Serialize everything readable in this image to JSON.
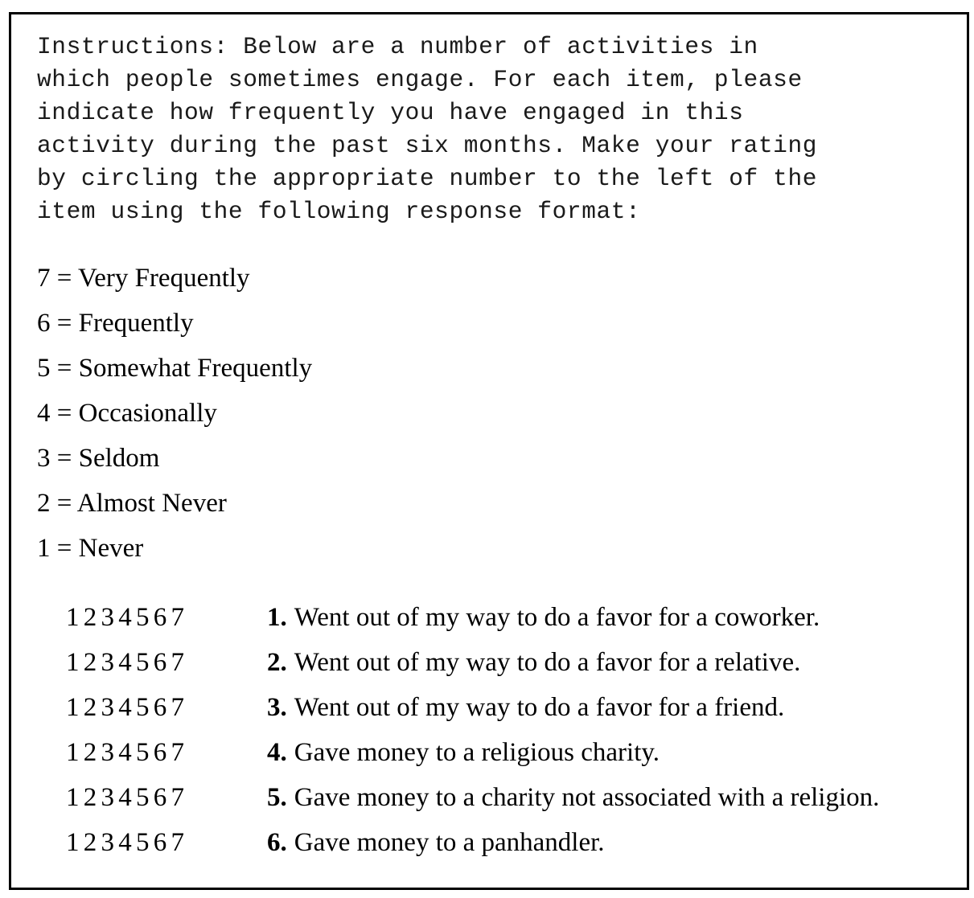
{
  "instructions": "Instructions: Below are a number of activities in\nwhich people sometimes engage. For each item, please\nindicate how frequently you have engaged in this\nactivity during the past six months. Make your rating\nby circling the appropriate number to the left of the\nitem using the following response format:",
  "scale": [
    {
      "value": "7",
      "label": "Very Frequently",
      "text": "7 = Very Frequently"
    },
    {
      "value": "6",
      "label": "Frequently",
      "text": "6 = Frequently"
    },
    {
      "value": "5",
      "label": "Somewhat Frequently",
      "text": "5 = Somewhat Frequently"
    },
    {
      "value": "4",
      "label": "Occasionally",
      "text": "4 = Occasionally"
    },
    {
      "value": "3",
      "label": "Seldom",
      "text": "3 = Seldom"
    },
    {
      "value": "2",
      "label": "Almost Never",
      "text": "2 = Almost Never"
    },
    {
      "value": "1",
      "label": "Never",
      "text": "1 = Never"
    }
  ],
  "rating_options": [
    "1",
    "2",
    "3",
    "4",
    "5",
    "6",
    "7"
  ],
  "items": [
    {
      "number": "1.",
      "text": "Went out of my way to do a favor for a coworker."
    },
    {
      "number": "2.",
      "text": "Went out of my way to do a favor for a relative."
    },
    {
      "number": "3.",
      "text": "Went out of my way to do a favor for a friend."
    },
    {
      "number": "4.",
      "text": "Gave money to a religious charity."
    },
    {
      "number": "5.",
      "text": "Gave money to a charity not associated with a religion."
    },
    {
      "number": "6.",
      "text": "Gave money to a panhandler."
    }
  ]
}
